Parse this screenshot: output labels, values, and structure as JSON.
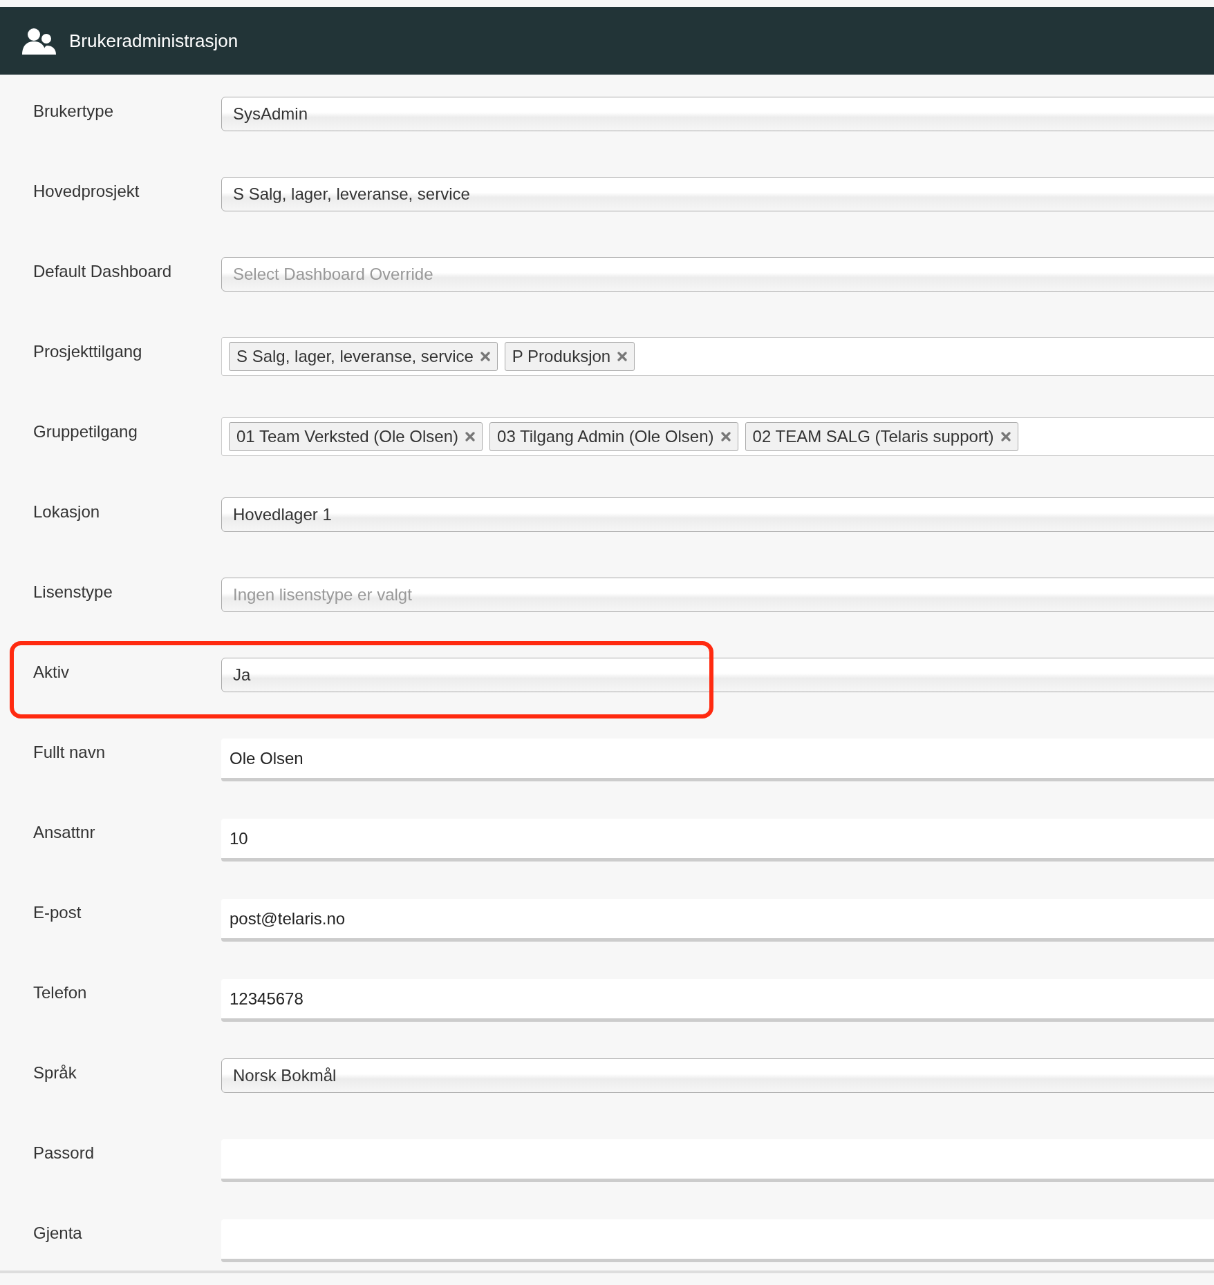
{
  "header": {
    "title": "Brukeradministrasjon"
  },
  "rows": [
    {
      "label": "Brukertype",
      "kind": "select",
      "value": "SysAdmin",
      "highlighted": false
    },
    {
      "label": "Hovedprosjekt",
      "kind": "select",
      "value": "S Salg, lager, leveranse, service",
      "highlighted": false
    },
    {
      "label": "Default Dashboard",
      "kind": "select",
      "placeholder": "Select Dashboard Override",
      "highlighted": false
    },
    {
      "label": "Prosjekttilgang",
      "kind": "tags",
      "tags": [
        "S Salg, lager, leveranse, service",
        "P Produksjon"
      ],
      "highlighted": false
    },
    {
      "label": "Gruppetilgang",
      "kind": "tags",
      "tags": [
        "01 Team Verksted (Ole Olsen)",
        "03 Tilgang Admin (Ole Olsen)",
        "02 TEAM SALG (Telaris support)"
      ],
      "highlighted": false
    },
    {
      "label": "Lokasjon",
      "kind": "select",
      "value": "Hovedlager 1",
      "highlighted": false
    },
    {
      "label": "Lisenstype",
      "kind": "select",
      "placeholder": "Ingen lisenstype er valgt",
      "highlighted": false
    },
    {
      "label": "Aktiv",
      "kind": "select",
      "value": "Ja",
      "highlighted": true
    },
    {
      "label": "Fullt navn",
      "kind": "text",
      "value": "Ole Olsen",
      "highlighted": false
    },
    {
      "label": "Ansattnr",
      "kind": "text",
      "value": "10",
      "highlighted": false
    },
    {
      "label": "E-post",
      "kind": "text",
      "value": "post@telaris.no",
      "highlighted": false
    },
    {
      "label": "Telefon",
      "kind": "text",
      "value": "12345678",
      "highlighted": false
    },
    {
      "label": "Språk",
      "kind": "select",
      "value": "Norsk Bokmål",
      "highlighted": false
    },
    {
      "label": "Passord",
      "kind": "text",
      "highlighted": false
    },
    {
      "label": "Gjenta",
      "kind": "text",
      "highlighted": false
    }
  ]
}
